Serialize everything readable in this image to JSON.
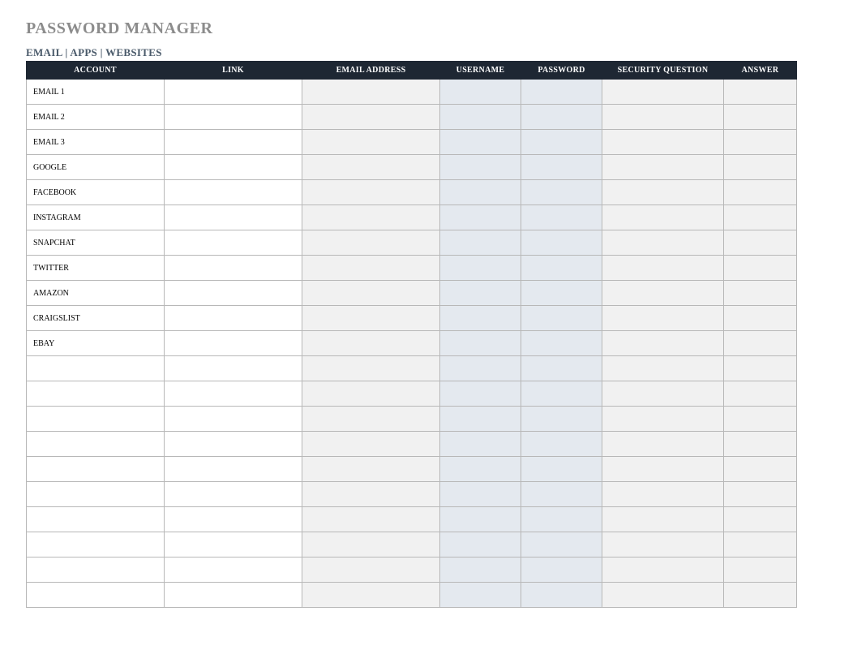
{
  "title": "PASSWORD MANAGER",
  "subtitle": "EMAIL | APPS | WEBSITES",
  "columns": [
    "ACCOUNT",
    "LINK",
    "EMAIL ADDRESS",
    "USERNAME",
    "PASSWORD",
    "SECURITY QUESTION",
    "ANSWER"
  ],
  "rows": [
    {
      "account": "EMAIL 1",
      "link": "",
      "email": "",
      "username": "",
      "password": "",
      "secq": "",
      "answer": ""
    },
    {
      "account": "EMAIL 2",
      "link": "",
      "email": "",
      "username": "",
      "password": "",
      "secq": "",
      "answer": ""
    },
    {
      "account": "EMAIL 3",
      "link": "",
      "email": "",
      "username": "",
      "password": "",
      "secq": "",
      "answer": ""
    },
    {
      "account": "GOOGLE",
      "link": "",
      "email": "",
      "username": "",
      "password": "",
      "secq": "",
      "answer": ""
    },
    {
      "account": "FACEBOOK",
      "link": "",
      "email": "",
      "username": "",
      "password": "",
      "secq": "",
      "answer": ""
    },
    {
      "account": "INSTAGRAM",
      "link": "",
      "email": "",
      "username": "",
      "password": "",
      "secq": "",
      "answer": ""
    },
    {
      "account": "SNAPCHAT",
      "link": "",
      "email": "",
      "username": "",
      "password": "",
      "secq": "",
      "answer": ""
    },
    {
      "account": "TWITTER",
      "link": "",
      "email": "",
      "username": "",
      "password": "",
      "secq": "",
      "answer": ""
    },
    {
      "account": "AMAZON",
      "link": "",
      "email": "",
      "username": "",
      "password": "",
      "secq": "",
      "answer": ""
    },
    {
      "account": "CRAIGSLIST",
      "link": "",
      "email": "",
      "username": "",
      "password": "",
      "secq": "",
      "answer": ""
    },
    {
      "account": "EBAY",
      "link": "",
      "email": "",
      "username": "",
      "password": "",
      "secq": "",
      "answer": ""
    },
    {
      "account": "",
      "link": "",
      "email": "",
      "username": "",
      "password": "",
      "secq": "",
      "answer": ""
    },
    {
      "account": "",
      "link": "",
      "email": "",
      "username": "",
      "password": "",
      "secq": "",
      "answer": ""
    },
    {
      "account": "",
      "link": "",
      "email": "",
      "username": "",
      "password": "",
      "secq": "",
      "answer": ""
    },
    {
      "account": "",
      "link": "",
      "email": "",
      "username": "",
      "password": "",
      "secq": "",
      "answer": ""
    },
    {
      "account": "",
      "link": "",
      "email": "",
      "username": "",
      "password": "",
      "secq": "",
      "answer": ""
    },
    {
      "account": "",
      "link": "",
      "email": "",
      "username": "",
      "password": "",
      "secq": "",
      "answer": ""
    },
    {
      "account": "",
      "link": "",
      "email": "",
      "username": "",
      "password": "",
      "secq": "",
      "answer": ""
    },
    {
      "account": "",
      "link": "",
      "email": "",
      "username": "",
      "password": "",
      "secq": "",
      "answer": ""
    },
    {
      "account": "",
      "link": "",
      "email": "",
      "username": "",
      "password": "",
      "secq": "",
      "answer": ""
    },
    {
      "account": "",
      "link": "",
      "email": "",
      "username": "",
      "password": "",
      "secq": "",
      "answer": ""
    }
  ]
}
